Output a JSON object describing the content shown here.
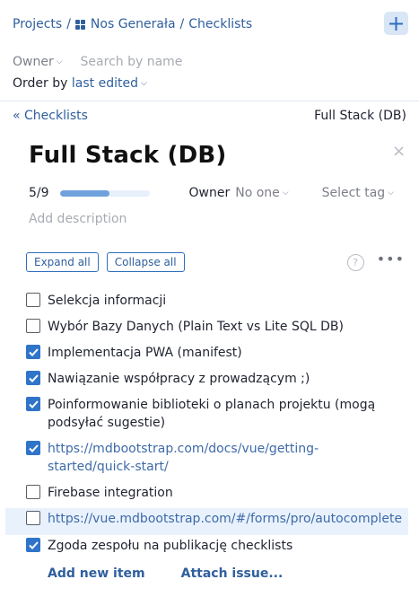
{
  "breadcrumb": {
    "projects": "Projects",
    "separator": "/",
    "project": "Nos Generała",
    "section": "Checklists"
  },
  "add_button_icon": "plus-icon",
  "filters": {
    "owner": "Owner",
    "search_placeholder": "Search by name",
    "order_prefix": "Order by",
    "order_value": "last edited"
  },
  "subnav": {
    "back": "Checklists",
    "current": "Full Stack (DB)"
  },
  "checklist": {
    "title": "Full Stack (DB)",
    "close_symbol": "×",
    "progress_text": "5/9",
    "progress_fraction": 0.556,
    "owner_label": "Owner",
    "owner_value": "No one",
    "tag_placeholder": "Select tag",
    "description_placeholder": "Add description"
  },
  "actions": {
    "expand": "Expand all",
    "collapse": "Collapse all",
    "help": "?",
    "more": "•••"
  },
  "items": [
    {
      "text": "Selekcja informacji",
      "checked": false,
      "link": false
    },
    {
      "text": "Wybór Bazy Danych (Plain Text vs Lite SQL DB)",
      "checked": false,
      "link": false
    },
    {
      "text": "Implementacja PWA (manifest)",
      "checked": true,
      "link": false
    },
    {
      "text": "Nawiązanie współpracy z prowadzącym ;)",
      "checked": true,
      "link": false
    },
    {
      "text": "Poinformowanie biblioteki o planach projektu (mogą podsyłać sugestie)",
      "checked": true,
      "link": false
    },
    {
      "text": "https://mdbootstrap.com/docs/vue/getting-started/quick-start/",
      "checked": true,
      "link": true
    },
    {
      "text": "Firebase integration",
      "checked": false,
      "link": false
    },
    {
      "text": "https://vue.mdbootstrap.com/#/forms/pro/autocomplete",
      "checked": false,
      "link": true,
      "highlighted": true
    },
    {
      "text": "Zgoda zespołu na publikację checklists",
      "checked": true,
      "link": false
    }
  ],
  "footer": {
    "add_item": "Add new item",
    "attach_issue": "Attach issue..."
  },
  "colors": {
    "accent": "#2f5f9e",
    "checkbox_checked": "#2f74c9",
    "progress_fill": "#6fa1dc",
    "highlight_row": "#e9f2fc"
  }
}
